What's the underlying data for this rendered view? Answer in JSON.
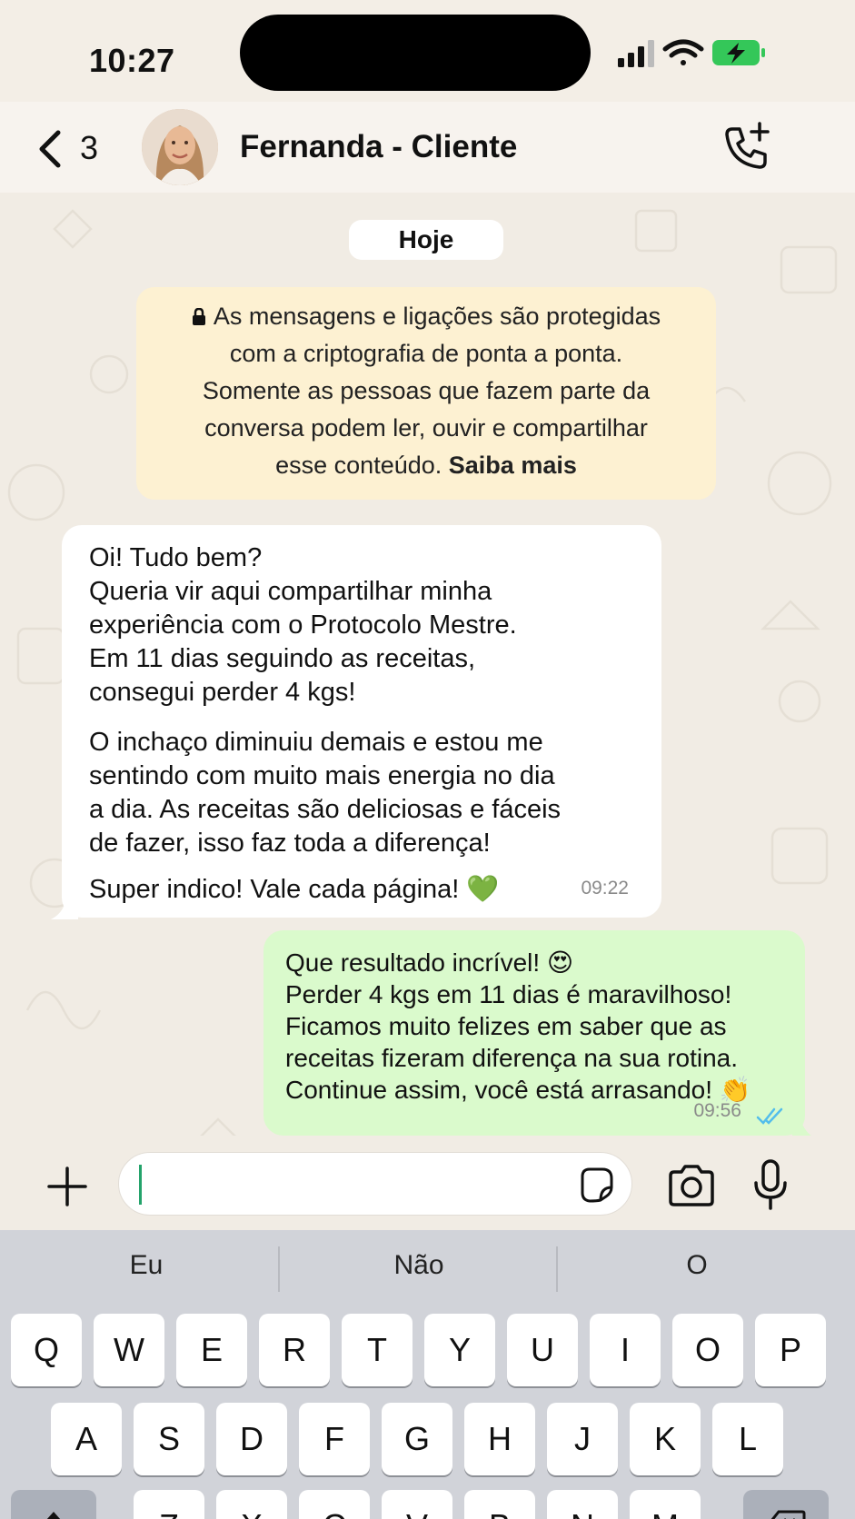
{
  "status_bar": {
    "time": "10:27"
  },
  "header": {
    "back_count": "3",
    "contact_name": "Fernanda - Cliente"
  },
  "chat": {
    "date_chip": "Hoje",
    "e2e_notice": {
      "lines": [
        "As mensagens e ligações são protegidas",
        "com a criptografia de ponta a ponta.",
        "Somente as pessoas que fazem parte da",
        "conversa podem ler, ouvir e compartilhar",
        "esse conteúdo."
      ],
      "link": "Saiba mais"
    },
    "incoming": {
      "paragraph1": [
        "Oi! Tudo bem?",
        "Queria vir aqui compartilhar minha",
        "experiência com o Protocolo Mestre.",
        "Em 11 dias seguindo as receitas,",
        "consegui perder 4 kgs!"
      ],
      "paragraph2": [
        "O inchaço diminuiu demais e estou me",
        "sentindo com muito mais energia no dia",
        "a dia. As receitas são deliciosas e fáceis",
        "de fazer, isso faz toda a diferença!"
      ],
      "paragraph3": "Super indico! Vale cada página! 💚",
      "time": "09:22"
    },
    "outgoing": {
      "lines": [
        "Que resultado incrível! 😍",
        "Perder 4 kgs em 11 dias é maravilhoso!",
        "Ficamos muito felizes em saber que as",
        "receitas fizeram diferença na sua rotina.",
        "Continue assim, você está arrasando! 👏"
      ],
      "time": "09:56",
      "status_icon": "double-check-read-icon"
    }
  },
  "composer": {
    "value": ""
  },
  "keyboard": {
    "suggestions": [
      "Eu",
      "Não",
      "O"
    ],
    "row1": [
      "Q",
      "W",
      "E",
      "R",
      "T",
      "Y",
      "U",
      "I",
      "O",
      "P"
    ],
    "row2": [
      "A",
      "S",
      "D",
      "F",
      "G",
      "H",
      "J",
      "K",
      "L"
    ],
    "row3": [
      "Z",
      "X",
      "C",
      "V",
      "B",
      "N",
      "M"
    ]
  },
  "colors": {
    "outgoing_bubble": "#dafacc",
    "notice_bg": "#fdf1d2",
    "read_ticks": "#53bdeb",
    "battery": "#34c759"
  }
}
